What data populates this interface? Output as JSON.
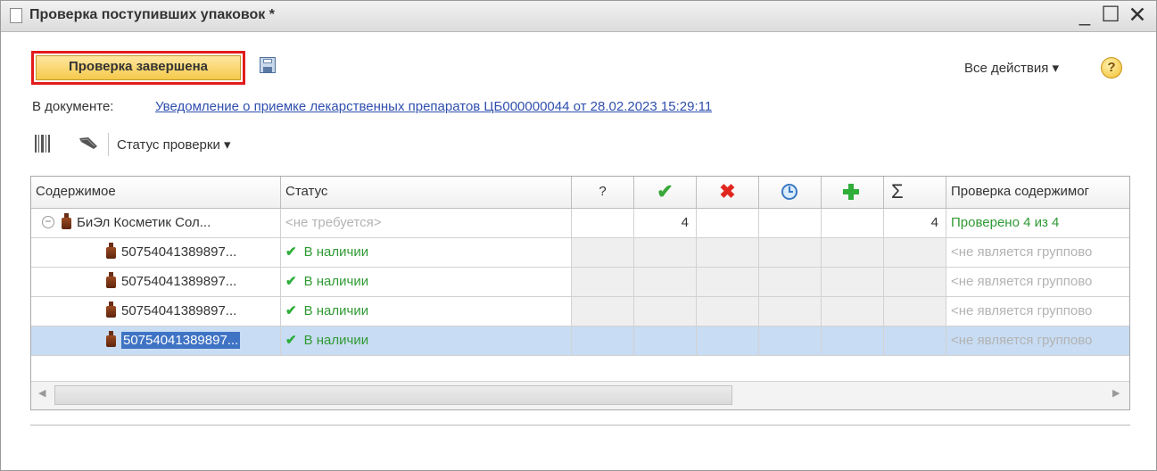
{
  "window": {
    "title": "Проверка поступивших упаковок *",
    "minimize": "_",
    "maximize": "☐",
    "close": "✕"
  },
  "toolbar": {
    "primary_label": "Проверка завершена",
    "all_actions_label": "Все действия ▾",
    "help_label": "?"
  },
  "document": {
    "label": "В документе:",
    "link_text": "Уведомление о приемке лекарственных препаратов ЦБ000000044 от 28.02.2023 15:29:11"
  },
  "table_toolbar": {
    "status_menu_label": "Статус проверки ▾"
  },
  "table": {
    "headers": {
      "content": "Содержимое",
      "status": "Статус",
      "unknown": "?",
      "sum": "Σ",
      "check": "Проверка содержимог"
    },
    "group_row": {
      "name": "БиЭл Косметик Сол...",
      "status": "<не требуется>",
      "found_count": "4",
      "total": "4",
      "check_result": "Проверено 4 из 4"
    },
    "rows": [
      {
        "code": "50754041389897...",
        "status": "В наличии",
        "check": "<не является группово"
      },
      {
        "code": "50754041389897...",
        "status": "В наличии",
        "check": "<не является группово"
      },
      {
        "code": "50754041389897...",
        "status": "В наличии",
        "check": "<не является группово"
      },
      {
        "code": "50754041389897...",
        "status": "В наличии",
        "check": "<не является группово"
      }
    ],
    "selected_row_index": 3
  },
  "colors": {
    "accent_button": "#f4c94a",
    "highlight_border": "#e21b1b",
    "link": "#2f4fae",
    "ok_green": "#2f9a34",
    "selection": "#c8dcf3"
  }
}
